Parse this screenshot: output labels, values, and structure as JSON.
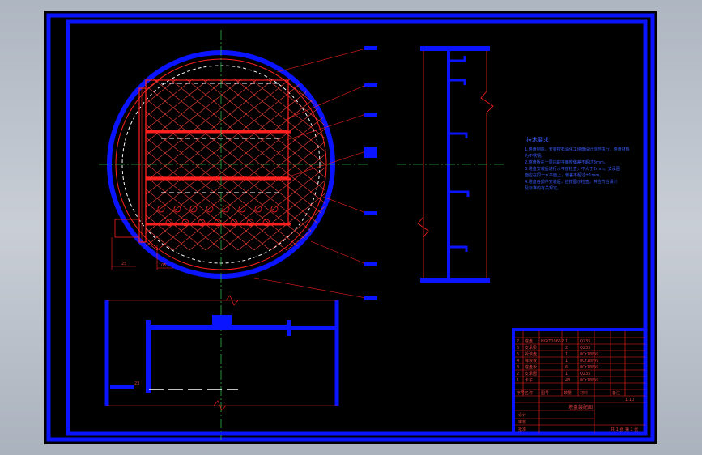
{
  "drawing": {
    "tech_requirements_title": "技术要求",
    "tech_requirements_lines": [
      "1.塔盘制造、安装按石油化工塔盘设计规范执行，塔盘材料",
      "  为不锈钢。",
      "2.塔盘板在一层内的平面度偏差不超过3mm。",
      "3.塔盘安装后进行水平度检查，不大于2mm。支承圈",
      "  面应在同一水平面上，偏差不超过±1mm。",
      "4.塔盘各部件安装后，应按图示检查，并应符合设计",
      "  及标准的有关规定。"
    ],
    "dimension_labels": {
      "left_width": "25",
      "left_offset": "105",
      "section_depth": "23"
    },
    "title_block": {
      "parts_rows": [
        [
          "7",
          "塔盘",
          "HG/T20652",
          "1",
          "Q235",
          ""
        ],
        [
          "6",
          "支承梁",
          "",
          "2",
          "Q235",
          ""
        ],
        [
          "5",
          "受液盘",
          "",
          "1",
          "0Cr18Ni9",
          ""
        ],
        [
          "4",
          "降液板",
          "",
          "1",
          "0Cr18Ni9",
          ""
        ],
        [
          "3",
          "塔盘板",
          "",
          "6",
          "0Cr18Ni9",
          ""
        ],
        [
          "2",
          "支承圈",
          "",
          "1",
          "Q235",
          ""
        ],
        [
          "1",
          "卡子",
          "",
          "48",
          "0Cr18Ni9",
          ""
        ]
      ],
      "header_row": [
        "序号",
        "名称",
        "图号",
        "数量",
        "材料",
        "备注"
      ],
      "drawing_name": "塔盘装配图",
      "scale": "1:10",
      "rows_bottom": [
        "设计",
        "审核",
        "批准"
      ],
      "sheet_info": "共 1 张 第 1 张"
    },
    "colors": {
      "frame": "#0b14ff",
      "line_red": "#ff2020",
      "center_green": "#2db34a",
      "white": "#ffffff"
    }
  }
}
